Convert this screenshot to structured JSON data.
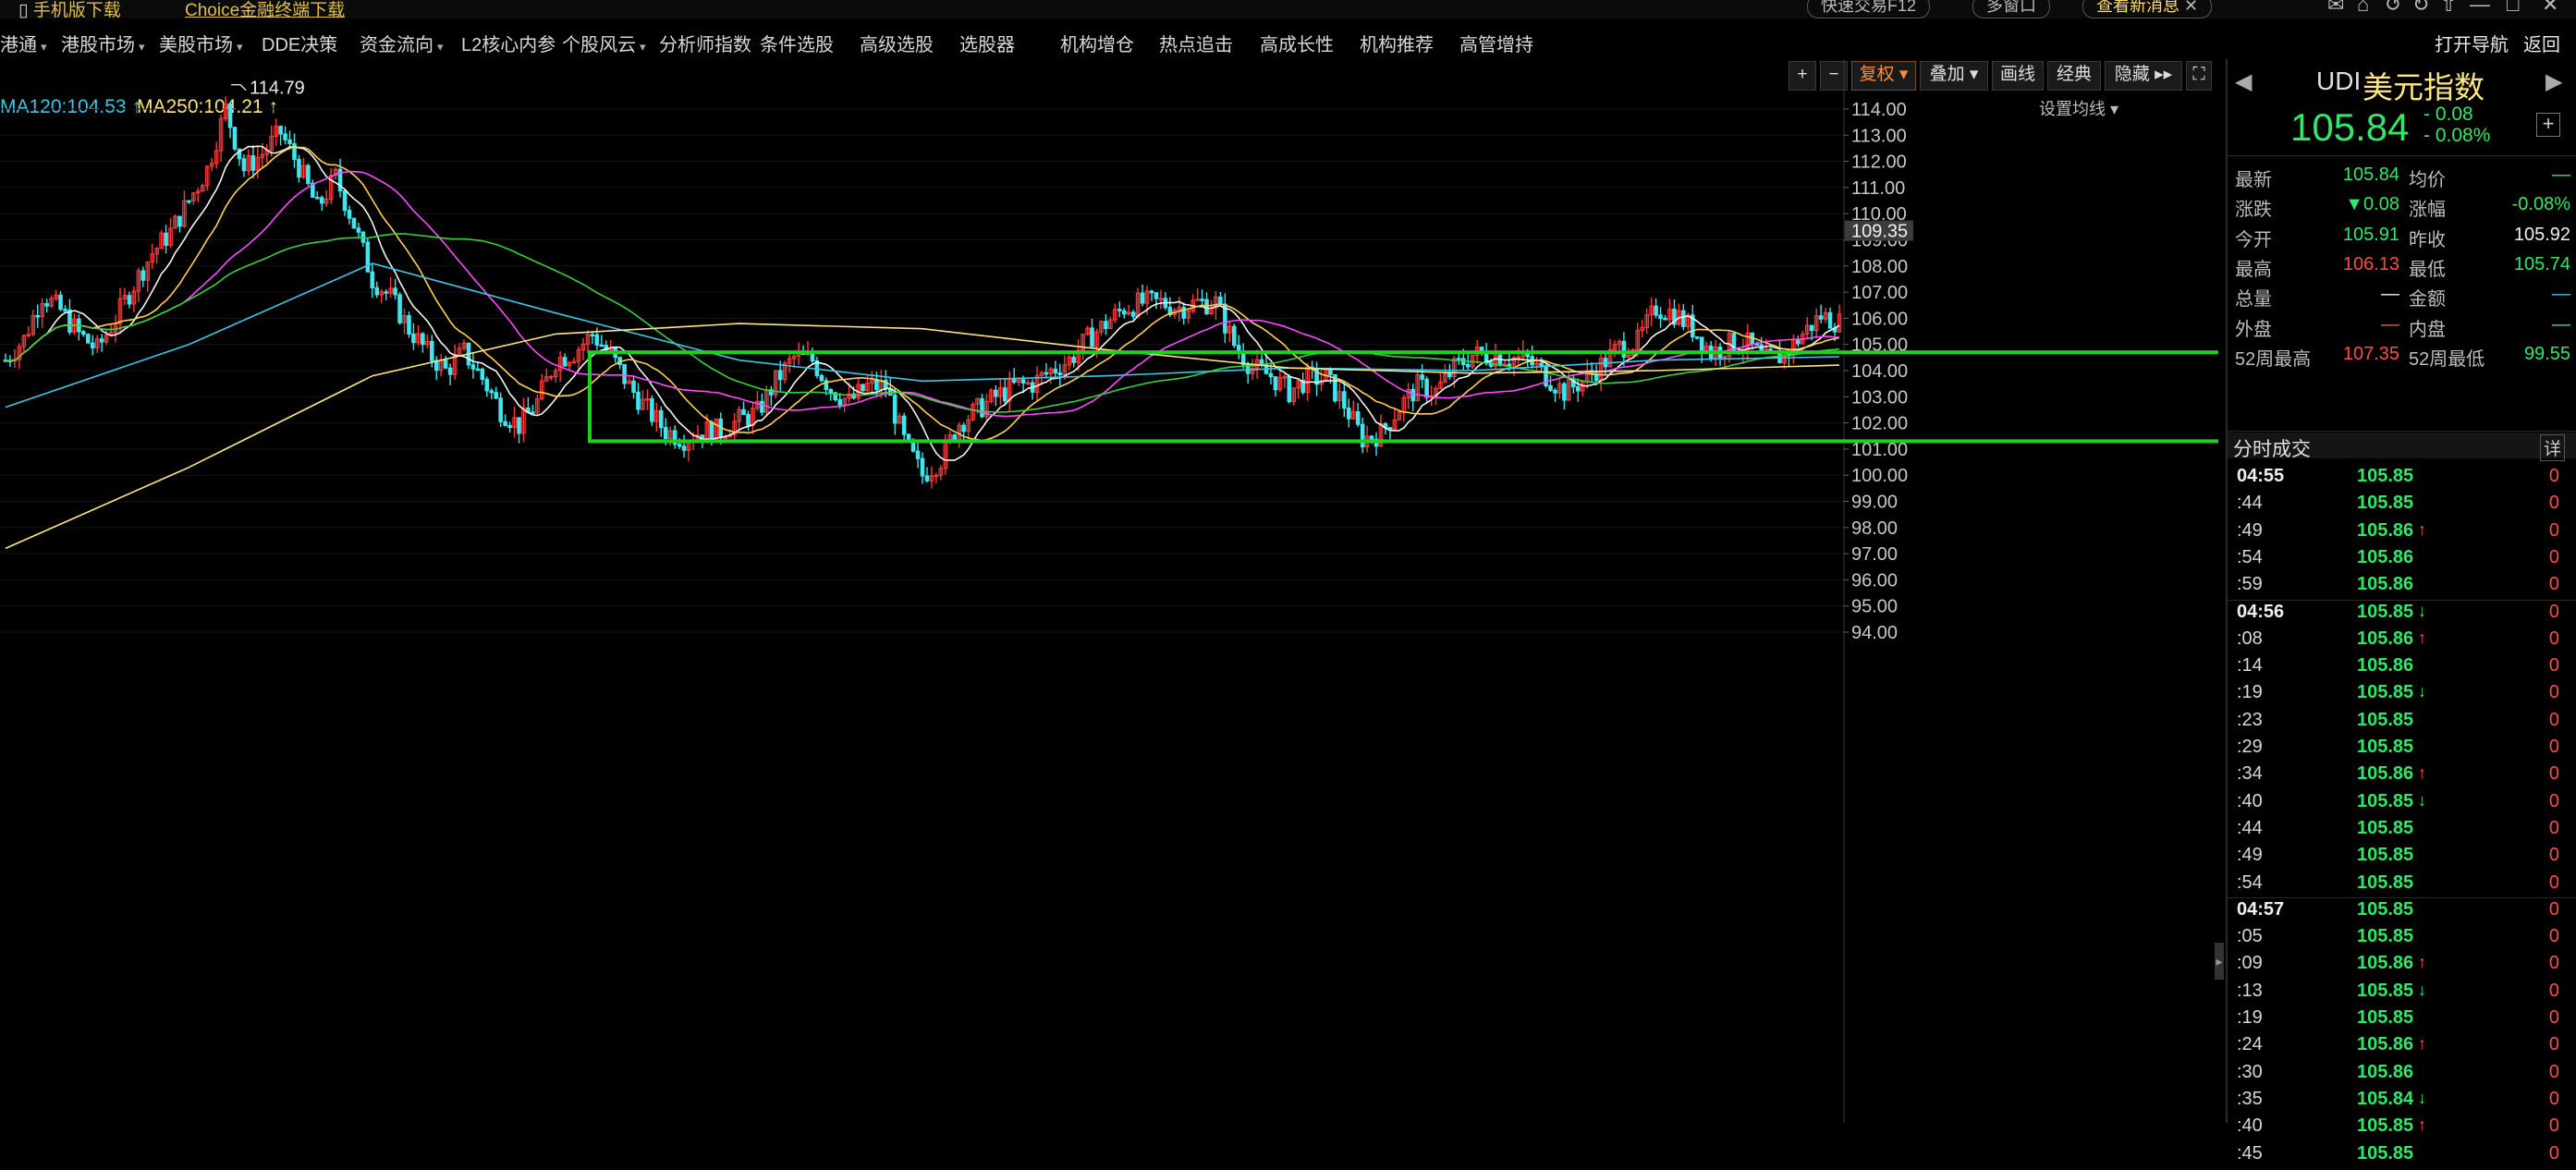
{
  "topbar": {
    "mobile_download": "手机版下载",
    "choice_download": "Choice金融终端下载",
    "quick_trade": "快速交易F12",
    "multi_window": "多窗口",
    "news_label": "查看新消息"
  },
  "nav": {
    "items": [
      {
        "label": "港通",
        "caret": true
      },
      {
        "label": "港股市场",
        "caret": true
      },
      {
        "label": "美股市场",
        "caret": true
      },
      {
        "label": "DDE决策",
        "caret": false
      },
      {
        "label": "资金流向",
        "caret": true
      },
      {
        "label": "L2核心内参",
        "caret": false
      },
      {
        "label": "个股风云",
        "caret": true
      },
      {
        "label": "分析师指数",
        "caret": false
      },
      {
        "label": "条件选股",
        "caret": false
      },
      {
        "label": "高级选股",
        "caret": false
      },
      {
        "label": "选股器",
        "caret": false
      },
      {
        "label": "机构增仓",
        "caret": false
      },
      {
        "label": "热点追击",
        "caret": false
      },
      {
        "label": "高成长性",
        "caret": false
      },
      {
        "label": "机构推荐",
        "caret": false
      },
      {
        "label": "高管增持",
        "caret": false
      }
    ],
    "open_nav": "打开导航",
    "back": "返回"
  },
  "toolbar": {
    "plus": "+",
    "minus": "−",
    "fuquan": "复权",
    "overlay": "叠加",
    "draw": "画线",
    "classic": "经典",
    "hide": "隐藏",
    "fullscreen_icon": "fullscreen-icon"
  },
  "ma": {
    "ma120": "MA120:104.53",
    "ma250": "MA250:104.21",
    "ma120_color": "#39c8e8",
    "ma250_color": "#ffe680",
    "settings": "设置均线"
  },
  "chart_data": {
    "type": "candlestick",
    "y_ticks": [
      "114.00",
      "113.00",
      "112.00",
      "111.00",
      "110.00",
      "109.00",
      "108.00",
      "107.00",
      "106.00",
      "105.00",
      "104.00",
      "103.00",
      "102.00",
      "101.00",
      "100.00",
      "99.00",
      "98.00",
      "97.00",
      "96.00",
      "95.00",
      "94.00"
    ],
    "ylim": [
      94,
      114.6
    ],
    "current_price_label": "109.35",
    "high_annotation": "114.79",
    "box": {
      "y_top": 104.7,
      "y_bottom": 101.3
    },
    "close_path": [
      [
        0,
        104.4
      ],
      [
        2,
        105.2
      ],
      [
        4,
        106.9
      ],
      [
        6,
        106.3
      ],
      [
        8,
        105.4
      ],
      [
        10,
        104.8
      ],
      [
        12,
        106.0
      ],
      [
        14,
        107.3
      ],
      [
        16,
        108.5
      ],
      [
        18,
        109.3
      ],
      [
        20,
        110.5
      ],
      [
        22,
        111.7
      ],
      [
        24,
        114.0
      ],
      [
        26,
        111.7
      ],
      [
        28,
        112.3
      ],
      [
        30,
        113.1
      ],
      [
        32,
        111.8
      ],
      [
        34,
        110.2
      ],
      [
        36,
        111.4
      ],
      [
        38,
        109.6
      ],
      [
        40,
        107.5
      ],
      [
        42,
        106.8
      ],
      [
        44,
        105.6
      ],
      [
        46,
        104.7
      ],
      [
        48,
        104.0
      ],
      [
        50,
        104.7
      ],
      [
        52,
        103.7
      ],
      [
        54,
        102.5
      ],
      [
        56,
        101.9
      ],
      [
        58,
        102.8
      ],
      [
        60,
        104.4
      ],
      [
        62,
        104.7
      ],
      [
        64,
        105.4
      ],
      [
        66,
        104.6
      ],
      [
        68,
        103.4
      ],
      [
        70,
        102.5
      ],
      [
        72,
        101.7
      ],
      [
        74,
        101.4
      ],
      [
        76,
        101.7
      ],
      [
        78,
        101.7
      ],
      [
        80,
        102.1
      ],
      [
        82,
        102.4
      ],
      [
        84,
        103.6
      ],
      [
        86,
        104.5
      ],
      [
        88,
        104.4
      ],
      [
        90,
        103.3
      ],
      [
        92,
        102.8
      ],
      [
        94,
        103.4
      ],
      [
        96,
        103.4
      ],
      [
        98,
        101.3
      ],
      [
        100,
        100.0
      ],
      [
        102,
        100.6
      ],
      [
        104,
        102.0
      ],
      [
        106,
        102.5
      ],
      [
        108,
        103.0
      ],
      [
        110,
        103.4
      ],
      [
        112,
        103.5
      ],
      [
        114,
        104.0
      ],
      [
        116,
        104.4
      ],
      [
        118,
        105.2
      ],
      [
        120,
        105.8
      ],
      [
        122,
        106.4
      ],
      [
        124,
        106.6
      ],
      [
        126,
        106.6
      ],
      [
        128,
        106.4
      ],
      [
        130,
        106.6
      ],
      [
        132,
        106.6
      ],
      [
        134,
        105.0
      ],
      [
        136,
        104.1
      ],
      [
        138,
        103.8
      ],
      [
        140,
        103.2
      ],
      [
        142,
        103.7
      ],
      [
        144,
        103.7
      ],
      [
        146,
        102.7
      ],
      [
        148,
        101.4
      ],
      [
        150,
        101.6
      ],
      [
        152,
        102.6
      ],
      [
        154,
        103.4
      ],
      [
        156,
        103.2
      ],
      [
        158,
        104.1
      ],
      [
        160,
        104.6
      ],
      [
        162,
        104.6
      ],
      [
        164,
        104.5
      ],
      [
        166,
        104.4
      ],
      [
        168,
        103.8
      ],
      [
        170,
        103.2
      ],
      [
        172,
        103.6
      ],
      [
        174,
        104.2
      ],
      [
        176,
        104.9
      ],
      [
        178,
        105.1
      ],
      [
        180,
        106.4
      ],
      [
        182,
        106.2
      ],
      [
        184,
        105.6
      ],
      [
        186,
        104.7
      ],
      [
        188,
        105.0
      ],
      [
        190,
        105.0
      ],
      [
        192,
        104.4
      ],
      [
        194,
        104.6
      ],
      [
        196,
        105.4
      ],
      [
        198,
        106.1
      ],
      [
        200,
        105.84
      ]
    ],
    "ma120_path": [
      [
        0,
        102.6
      ],
      [
        20,
        105.0
      ],
      [
        40,
        108.1
      ],
      [
        60,
        106.2
      ],
      [
        80,
        104.4
      ],
      [
        100,
        103.6
      ],
      [
        120,
        103.8
      ],
      [
        140,
        104.1
      ],
      [
        160,
        104.0
      ],
      [
        180,
        104.4
      ],
      [
        200,
        104.53
      ]
    ],
    "ma250_path": [
      [
        0,
        97.2
      ],
      [
        20,
        100.3
      ],
      [
        40,
        103.8
      ],
      [
        60,
        105.4
      ],
      [
        80,
        105.8
      ],
      [
        100,
        105.6
      ],
      [
        120,
        104.8
      ],
      [
        140,
        104.1
      ],
      [
        160,
        103.9
      ],
      [
        180,
        104.0
      ],
      [
        200,
        104.21
      ]
    ]
  },
  "quote": {
    "code": "UDI",
    "name": "美元指数",
    "price": "105.84",
    "change": "- 0.08",
    "change_pct": "- 0.08%",
    "rows": [
      {
        "l1": "最新",
        "v1": "105.84",
        "c1": "green",
        "l2": "均价",
        "v2": "—",
        "c2": "green"
      },
      {
        "l1": "涨跌",
        "v1": "▼0.08",
        "c1": "green",
        "l2": "涨幅",
        "v2": "-0.08%",
        "c2": "green"
      },
      {
        "l1": "今开",
        "v1": "105.91",
        "c1": "green",
        "l2": "昨收",
        "v2": "105.92",
        "c2": "white"
      },
      {
        "l1": "最高",
        "v1": "106.13",
        "c1": "red",
        "l2": "最低",
        "v2": "105.74",
        "c2": "green"
      },
      {
        "l1": "总量",
        "v1": "—",
        "c1": "white",
        "l2": "金额",
        "v2": "—",
        "c2": "cyan"
      },
      {
        "l1": "外盘",
        "v1": "—",
        "c1": "red",
        "l2": "内盘",
        "v2": "—",
        "c2": "green"
      },
      {
        "l1": "52周最高",
        "v1": "107.35",
        "c1": "red",
        "l2": "52周最低",
        "v2": "99.55",
        "c2": "green"
      }
    ],
    "ticks_header": "分时成交",
    "ticks_detail": "详",
    "ticks": [
      {
        "t": "04:55",
        "p": "105.85",
        "a": "",
        "v": "0",
        "bold": true
      },
      {
        "t": ":44",
        "p": "105.85",
        "a": "",
        "v": "0"
      },
      {
        "t": ":49",
        "p": "105.86",
        "a": "↑",
        "v": "0"
      },
      {
        "t": ":54",
        "p": "105.86",
        "a": "",
        "v": "0"
      },
      {
        "t": ":59",
        "p": "105.86",
        "a": "",
        "v": "0"
      },
      {
        "t": "04:56",
        "p": "105.85",
        "a": "↓",
        "v": "0",
        "bold": true
      },
      {
        "t": ":08",
        "p": "105.86",
        "a": "↑",
        "v": "0"
      },
      {
        "t": ":14",
        "p": "105.86",
        "a": "",
        "v": "0"
      },
      {
        "t": ":19",
        "p": "105.85",
        "a": "↓",
        "v": "0"
      },
      {
        "t": ":23",
        "p": "105.85",
        "a": "",
        "v": "0"
      },
      {
        "t": ":29",
        "p": "105.85",
        "a": "",
        "v": "0"
      },
      {
        "t": ":34",
        "p": "105.86",
        "a": "↑",
        "v": "0"
      },
      {
        "t": ":40",
        "p": "105.85",
        "a": "↓",
        "v": "0"
      },
      {
        "t": ":44",
        "p": "105.85",
        "a": "",
        "v": "0"
      },
      {
        "t": ":49",
        "p": "105.85",
        "a": "",
        "v": "0"
      },
      {
        "t": ":54",
        "p": "105.85",
        "a": "",
        "v": "0"
      },
      {
        "t": "04:57",
        "p": "105.85",
        "a": "",
        "v": "0",
        "bold": true
      },
      {
        "t": ":05",
        "p": "105.85",
        "a": "",
        "v": "0"
      },
      {
        "t": ":09",
        "p": "105.86",
        "a": "↑",
        "v": "0"
      },
      {
        "t": ":13",
        "p": "105.85",
        "a": "↓",
        "v": "0"
      },
      {
        "t": ":19",
        "p": "105.85",
        "a": "",
        "v": "0"
      },
      {
        "t": ":24",
        "p": "105.86",
        "a": "↑",
        "v": "0"
      },
      {
        "t": ":30",
        "p": "105.86",
        "a": "",
        "v": "0"
      },
      {
        "t": ":35",
        "p": "105.84",
        "a": "↓",
        "v": "0"
      },
      {
        "t": ":40",
        "p": "105.85",
        "a": "↑",
        "v": "0"
      },
      {
        "t": ":45",
        "p": "105.85",
        "a": "",
        "v": "0"
      }
    ]
  }
}
